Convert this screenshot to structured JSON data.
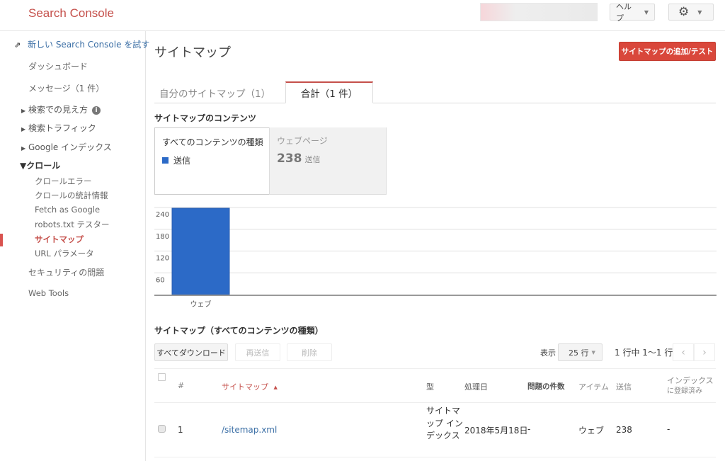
{
  "header": {
    "brand": "Search Console",
    "help_label": "ヘルプ",
    "help_caret": "▼",
    "settings_icon": "gear-icon",
    "settings_caret": "▼"
  },
  "sidebar": {
    "new_console_link": "新しい Search Console を試す",
    "dashboard": "ダッシュボード",
    "messages": "メッセージ（1 件）",
    "search_appearance": "検索での見え方",
    "search_traffic": "検索トラフィック",
    "google_index": "Google インデックス",
    "crawl": "クロール",
    "crawl_items": [
      {
        "label": "クロールエラー",
        "active": false
      },
      {
        "label": "クロールの統計情報",
        "active": false
      },
      {
        "label": "Fetch as Google",
        "active": false
      },
      {
        "label": "robots.txt テスター",
        "active": false
      },
      {
        "label": "サイトマップ",
        "active": true
      },
      {
        "label": "URL パラメータ",
        "active": false
      }
    ],
    "security": "セキュリティの問題",
    "web_tools": "Web Tools"
  },
  "main": {
    "title": "サイトマップ",
    "add_button": "サイトマップの追加/テスト",
    "tabs": [
      {
        "label": "自分のサイトマップ（1）",
        "active": false
      },
      {
        "label": "合計（1 件）",
        "active": true
      }
    ],
    "contents_heading": "サイトマップのコンテンツ",
    "content_type_box": {
      "title": "すべてのコンテンツの種類",
      "legend": "送信",
      "legend_color": "#2c6ac7"
    },
    "web_box": {
      "title": "ウェブページ",
      "value": "238",
      "unit": "送信"
    },
    "table_heading": "サイトマップ（すべてのコンテンツの種類）",
    "toolbar": {
      "download_all": "すべてダウンロード",
      "resend": "再送信",
      "delete": "削除",
      "show_label": "表示",
      "rows_per_page": "25 行",
      "range": "1 行中 1〜1 行",
      "prev": "‹",
      "next": "›"
    },
    "table": {
      "columns": {
        "num": "#",
        "sitemap": "サイトマップ",
        "sort_indicator": "▲",
        "type": "型",
        "processed": "処理日",
        "issues": "問題の件数",
        "items": "アイテム",
        "submitted": "送信",
        "indexed_1": "インデックス",
        "indexed_2": "に登録済み"
      },
      "rows": [
        {
          "num": "1",
          "sitemap": "/sitemap.xml",
          "type": "サイトマップ インデックス",
          "processed": "2018年5月18日",
          "issues": "-",
          "items": "ウェブ",
          "submitted": "238",
          "indexed": "-"
        }
      ]
    }
  },
  "chart_data": {
    "type": "bar",
    "categories": [
      "ウェブ"
    ],
    "series": [
      {
        "name": "送信",
        "values": [
          238
        ],
        "color": "#2c6ac7"
      }
    ],
    "yticks": [
      60,
      120,
      180,
      240
    ],
    "ylim": [
      0,
      240
    ],
    "title": "",
    "xlabel": "",
    "ylabel": "",
    "grid": true,
    "legend": "none"
  }
}
